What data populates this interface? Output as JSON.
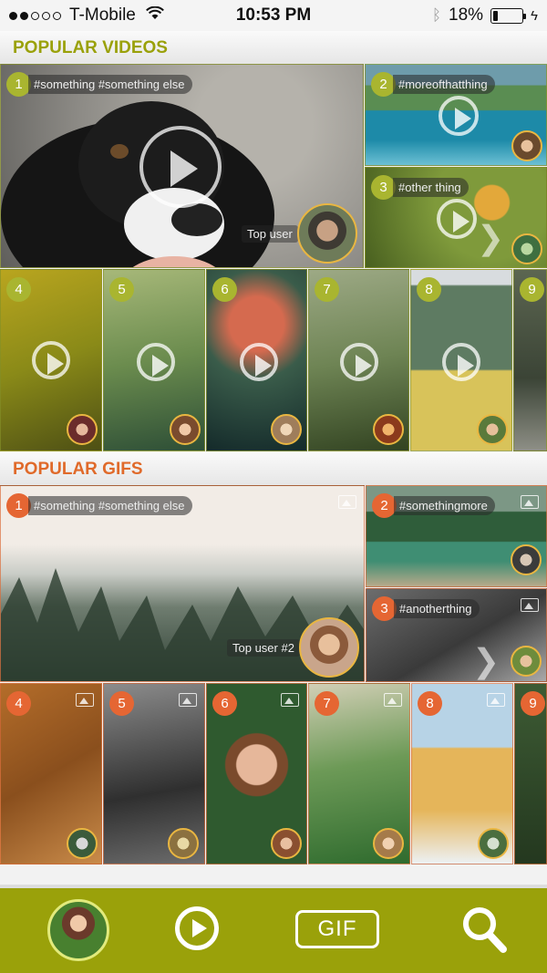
{
  "status_bar": {
    "carrier": "T-Mobile",
    "time": "10:53 PM",
    "battery": "18%",
    "battery_level": 0.18,
    "signal_bars": 2
  },
  "sections": {
    "videos_title": "POPULAR VIDEOS",
    "gifs_title": "POPULAR GIFS"
  },
  "videos": [
    {
      "rank": "1",
      "tag": "#something #something else",
      "top_user": "Top user"
    },
    {
      "rank": "2",
      "tag": "#moreofthatthing"
    },
    {
      "rank": "3",
      "tag": "#other thing"
    },
    {
      "rank": "4"
    },
    {
      "rank": "5"
    },
    {
      "rank": "6"
    },
    {
      "rank": "7"
    },
    {
      "rank": "8"
    },
    {
      "rank": "9"
    }
  ],
  "gifs": [
    {
      "rank": "1",
      "tag": "#something #something else",
      "top_user": "Top user #2"
    },
    {
      "rank": "2",
      "tag": "#somethingmore"
    },
    {
      "rank": "3",
      "tag": "#anotherthing"
    },
    {
      "rank": "4"
    },
    {
      "rank": "5"
    },
    {
      "rank": "6"
    },
    {
      "rank": "7"
    },
    {
      "rank": "8"
    },
    {
      "rank": "9"
    }
  ],
  "nav": {
    "gif_label": "GIF"
  },
  "colors": {
    "video_accent": "#9aa10a",
    "gif_accent": "#e06a2a",
    "avatar_ring": "#e9b641"
  },
  "icons": [
    "wifi-icon",
    "bluetooth-icon",
    "battery-icon",
    "play-icon",
    "image-icon",
    "chevron-right-icon",
    "search-icon"
  ]
}
